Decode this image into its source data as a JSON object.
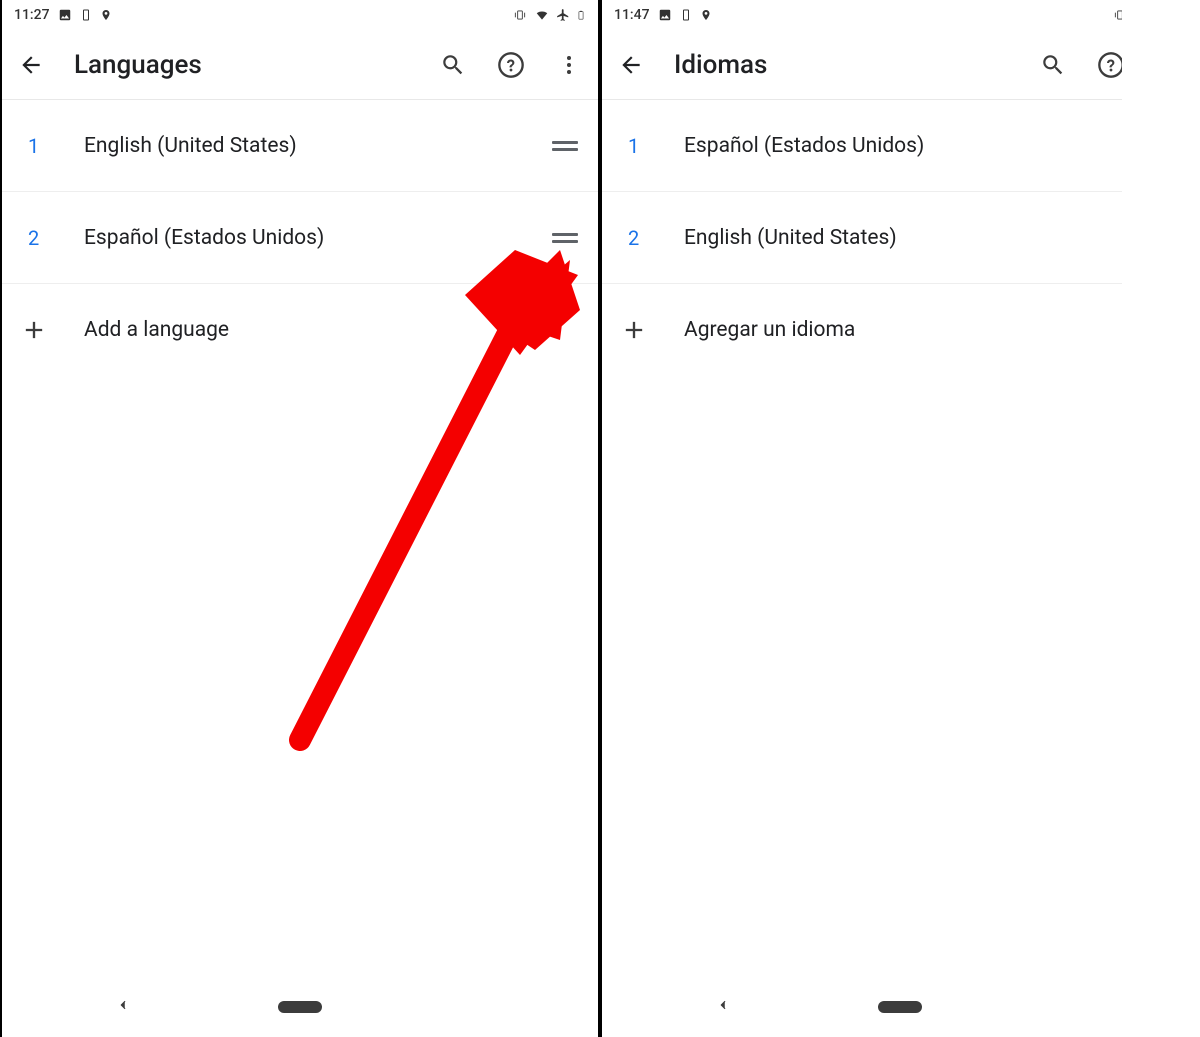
{
  "annotation": {
    "arrow_color": "#f40000"
  },
  "screens": [
    {
      "status": {
        "time": "11:27"
      },
      "appbar": {
        "title": "Languages"
      },
      "languages": [
        {
          "index": "1",
          "name": "English (United States)"
        },
        {
          "index": "2",
          "name": "Español (Estados Unidos)"
        }
      ],
      "add_label": "Add a language"
    },
    {
      "status": {
        "time": "11:47"
      },
      "appbar": {
        "title": "Idiomas"
      },
      "languages": [
        {
          "index": "1",
          "name": "Español (Estados Unidos)"
        },
        {
          "index": "2",
          "name": "English (United States)"
        }
      ],
      "add_label": "Agregar un idioma"
    }
  ]
}
